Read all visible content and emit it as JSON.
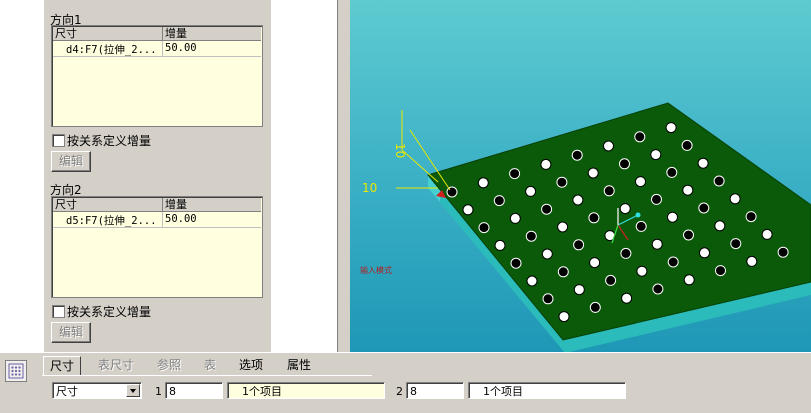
{
  "direction1": {
    "label": "方向1",
    "columns": [
      "尺寸",
      "增量"
    ],
    "rows": [
      {
        "dimension": "d4:F7(拉伸_2...",
        "increment": "50.00"
      }
    ],
    "checkbox_label": "按关系定义增量",
    "edit_button": "编辑"
  },
  "direction2": {
    "label": "方向2",
    "columns": [
      "尺寸",
      "增量"
    ],
    "rows": [
      {
        "dimension": "d5:F7(拉伸_2...",
        "increment": "50.00"
      }
    ],
    "checkbox_label": "按关系定义增量",
    "edit_button": "编辑"
  },
  "viewport": {
    "dim_vertical": "10",
    "dim_horizontal": "10",
    "status_text": "输入模式",
    "colors": {
      "plate_top": "#0a5a0a",
      "plate_side": "#2bbbbb",
      "background": "#3fb3c7"
    }
  },
  "dashboard": {
    "tabs": [
      {
        "label": "尺寸",
        "state": "active"
      },
      {
        "label": "表尺寸",
        "state": "disabled"
      },
      {
        "label": "参照",
        "state": "disabled"
      },
      {
        "label": "表",
        "state": "disabled"
      },
      {
        "label": "选项",
        "state": "normal"
      },
      {
        "label": "属性",
        "state": "normal"
      }
    ],
    "type_select": "尺寸",
    "dir1_index": "1",
    "dir1_count": "8",
    "dir1_items": "1个项目",
    "dir2_index": "2",
    "dir2_count": "8",
    "dir2_items": "1个项目"
  }
}
